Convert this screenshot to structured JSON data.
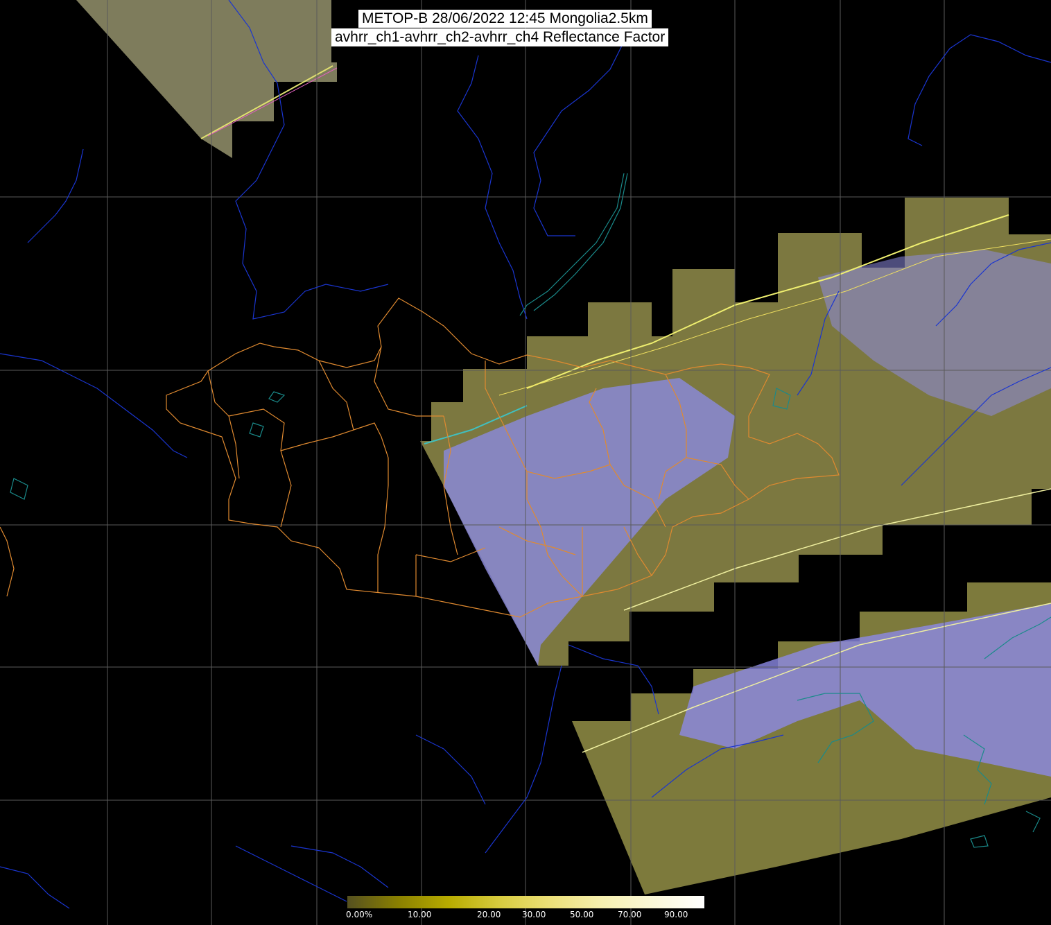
{
  "title": {
    "line1": "METOP-B 28/06/2022 12:45 Mongolia2.5km",
    "line2": "avhrr_ch1-avhrr_ch2-avhrr_ch4 Reflectance Factor"
  },
  "colors": {
    "background": "#000000",
    "grid": "#5a5a5a",
    "rivers": "#1a35d0",
    "coast": "#1a8a8a",
    "admin_borders": "#e08a30",
    "land_reflectance": "#7f7a3a",
    "cloud_reflectance": "#8a8af0"
  },
  "colorbar": {
    "labels": [
      "0.00%",
      "10.00",
      "20.00",
      "30.00",
      "50.00",
      "70.00",
      "90.00"
    ],
    "gradient": [
      "#555020",
      "#8a8000",
      "#b8ac00",
      "#d8cc40",
      "#ece07a",
      "#f6f0b0",
      "#fbf8d8",
      "#ffffff"
    ]
  }
}
